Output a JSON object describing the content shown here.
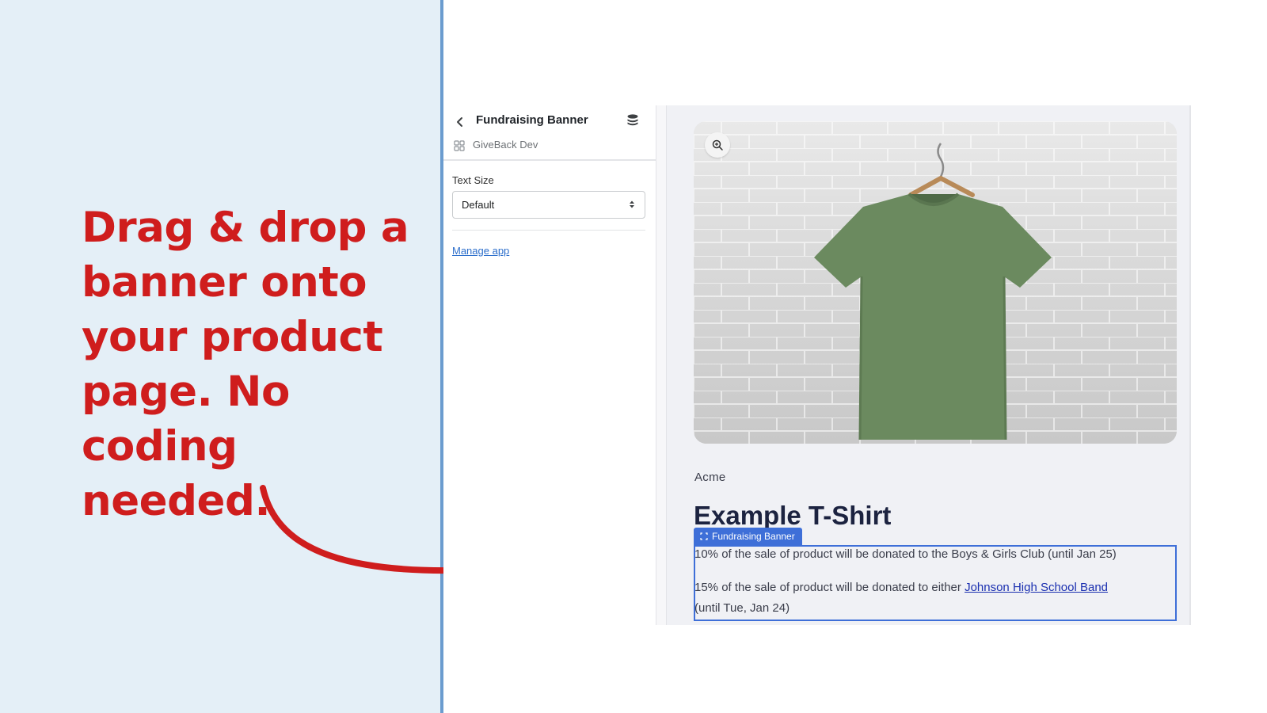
{
  "promo": {
    "headline": "Drag & drop a banner onto your product page. No coding needed."
  },
  "colors": {
    "headline": "#cf1d1d",
    "left_background": "#e4eff7",
    "divider": "#6b9ccf",
    "banner_accent": "#3e6fd8",
    "link": "#2c6ecb"
  },
  "editor": {
    "title": "Fundraising Banner",
    "app_name": "GiveBack Dev",
    "back_icon": "chevron-left-icon",
    "stack_icon": "database-icon",
    "text_size_label": "Text Size",
    "text_size_value": "Default",
    "manage_link": "Manage app"
  },
  "preview": {
    "vendor": "Acme",
    "product_title": "Example T-Shirt",
    "image_alt": "green t-shirt on hanger",
    "zoom_icon": "zoom-in-icon",
    "banner_tag": "Fundraising Banner",
    "banner_line_1": "10% of the sale of product will be donated to the Boys & Girls Club (until Jan 25)",
    "banner_line_2_prefix": "15% of the sale of product will be donated to either ",
    "banner_line_2_link": "Johnson High School Band",
    "banner_line_3": "(until Tue, Jan 24)"
  }
}
